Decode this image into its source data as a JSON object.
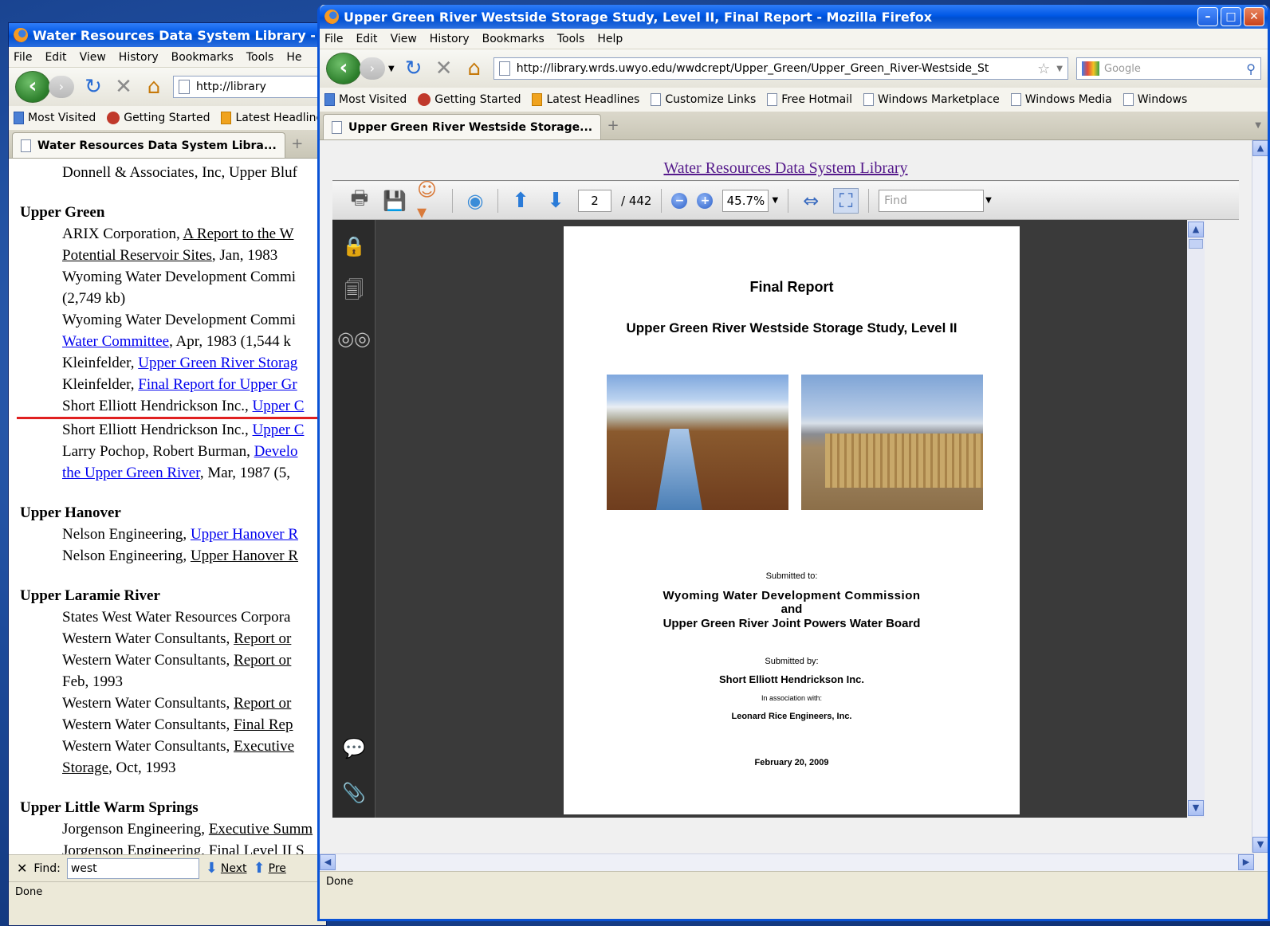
{
  "back_window": {
    "title": "Water Resources Data System Library - Wa",
    "menu": [
      "File",
      "Edit",
      "View",
      "History",
      "Bookmarks",
      "Tools",
      "He"
    ],
    "url": "http://library",
    "bookmarks": [
      "Most Visited",
      "Getting Started",
      "Latest Headline"
    ],
    "tab_label": "Water Resources Data System Libra...",
    "content": {
      "top_line": "Donnell & Associates, Inc, Upper Bluf",
      "sections": [
        {
          "title": "Upper Green",
          "entries": [
            {
              "pre": "ARIX Corporation, ",
              "link": "A Report to the W",
              "style": "u"
            },
            {
              "pre": "",
              "link": "Potential Reservoir Sites",
              "post": ", Jan, 1983",
              "style": "u"
            },
            {
              "pre": "Wyoming Water Development Commi",
              "style": "plain"
            },
            {
              "pre": "(2,749 kb)",
              "style": "plain"
            },
            {
              "pre": "Wyoming Water Development Commi",
              "style": "plain"
            },
            {
              "pre": "",
              "link": "Water Committee",
              "post": ", Apr, 1983 (1,544 k",
              "style": "a"
            },
            {
              "pre": "Kleinfelder, ",
              "link": "Upper Green River Storag",
              "style": "a"
            },
            {
              "pre": "Kleinfelder, ",
              "link": "Final Report for Upper Gr",
              "style": "a"
            },
            {
              "pre": "Short Elliott Hendrickson Inc., ",
              "link": "Upper C",
              "style": "a",
              "highlight": true
            },
            {
              "pre": "Short Elliott Hendrickson Inc., ",
              "link": "Upper C",
              "style": "a"
            },
            {
              "pre": "Larry Pochop, Robert Burman, ",
              "link": "Develo",
              "style": "a"
            },
            {
              "pre": "",
              "link": "the Upper Green River",
              "post": ", Mar, 1987 (5,",
              "style": "a"
            }
          ]
        },
        {
          "title": "Upper Hanover",
          "entries": [
            {
              "pre": "Nelson Engineering, ",
              "link": "Upper Hanover R",
              "style": "a"
            },
            {
              "pre": "Nelson Engineering, ",
              "link": "Upper Hanover R",
              "style": "u"
            }
          ]
        },
        {
          "title": "Upper Laramie River",
          "entries": [
            {
              "pre": "States West Water Resources Corpora",
              "style": "plain"
            },
            {
              "pre": "Western Water Consultants, ",
              "link": "Report or",
              "style": "u"
            },
            {
              "pre": "Western Water Consultants, ",
              "link": "Report or",
              "style": "u"
            },
            {
              "pre": "Feb, 1993",
              "style": "plain"
            },
            {
              "pre": "Western Water Consultants, ",
              "link": "Report or",
              "style": "u"
            },
            {
              "pre": "Western Water Consultants, ",
              "link": "Final Rep",
              "style": "u"
            },
            {
              "pre": "Western Water Consultants, ",
              "link": "Executive",
              "style": "u"
            },
            {
              "pre": "",
              "link": "Storage",
              "post": ", Oct, 1993",
              "style": "u"
            }
          ]
        },
        {
          "title": "Upper Little Warm Springs",
          "entries": [
            {
              "pre": "Jorgenson Engineering, ",
              "link": "Executive Summ",
              "style": "u"
            },
            {
              "pre": "Jorgenson Engineering, Final Level II S",
              "style": "plain"
            }
          ]
        }
      ]
    },
    "find": {
      "label": "Find:",
      "value": "west",
      "next": "Next",
      "prev": "Pre"
    },
    "status": "Done"
  },
  "front_window": {
    "title": "Upper Green River Westside Storage Study, Level II, Final Report - Mozilla Firefox",
    "menu": [
      "File",
      "Edit",
      "View",
      "History",
      "Bookmarks",
      "Tools",
      "Help"
    ],
    "url": "http://library.wrds.uwyo.edu/wwdcrept/Upper_Green/Upper_Green_River-Westside_St",
    "search_placeholder": "Google",
    "bookmarks": [
      "Most Visited",
      "Getting Started",
      "Latest Headlines",
      "Customize Links",
      "Free Hotmail",
      "Windows Marketplace",
      "Windows Media",
      "Windows"
    ],
    "tab_label": "Upper Green River Westside Storage...",
    "library_link": "Water Resources Data System Library",
    "pdf_toolbar": {
      "page_current": "2",
      "page_total": "/ 442",
      "zoom": "45.7%",
      "find_placeholder": "Find"
    },
    "pdf_page": {
      "title": "Final Report",
      "subtitle": "Upper Green River Westside Storage Study, Level II",
      "submitted_to_label": "Submitted to:",
      "submitted_to_1": "Wyoming Water Development Commission",
      "submitted_to_and": "and",
      "submitted_to_2": "Upper Green River Joint Powers Water Board",
      "submitted_by_label": "Submitted by:",
      "submitted_by": "Short Elliott Hendrickson Inc.",
      "association_label": "In association with:",
      "association": "Leonard Rice Engineers, Inc.",
      "date": "February 20, 2009"
    },
    "status": "Done"
  }
}
